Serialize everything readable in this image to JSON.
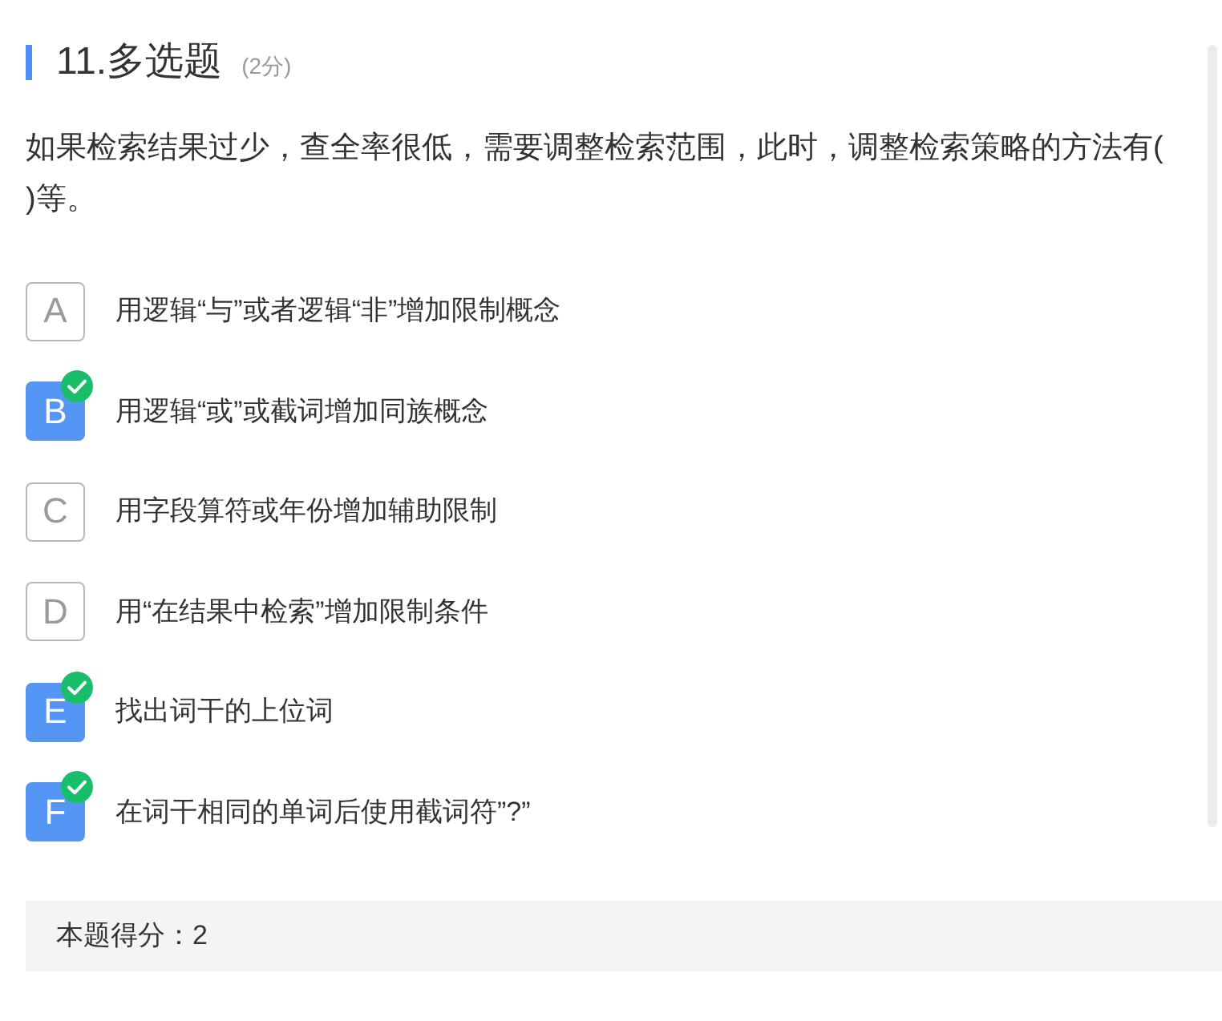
{
  "question": {
    "title": "11.多选题",
    "points": "(2分)",
    "stem": "如果检索结果过少，查全率很低，需要调整检索范围，此时，调整检索策略的方法有( )等。"
  },
  "options": [
    {
      "letter": "A",
      "text": "用逻辑“与”或者逻辑“非”增加限制概念",
      "selected": false
    },
    {
      "letter": "B",
      "text": "用逻辑“或”或截词增加同族概念",
      "selected": true
    },
    {
      "letter": "C",
      "text": "用字段算符或年份增加辅助限制",
      "selected": false
    },
    {
      "letter": "D",
      "text": "用“在结果中检索”增加限制条件",
      "selected": false
    },
    {
      "letter": "E",
      "text": "找出词干的上位词",
      "selected": true
    },
    {
      "letter": "F",
      "text": "在词干相同的单词后使用截词符”?”",
      "selected": true
    }
  ],
  "score": {
    "text": "本题得分：2"
  }
}
